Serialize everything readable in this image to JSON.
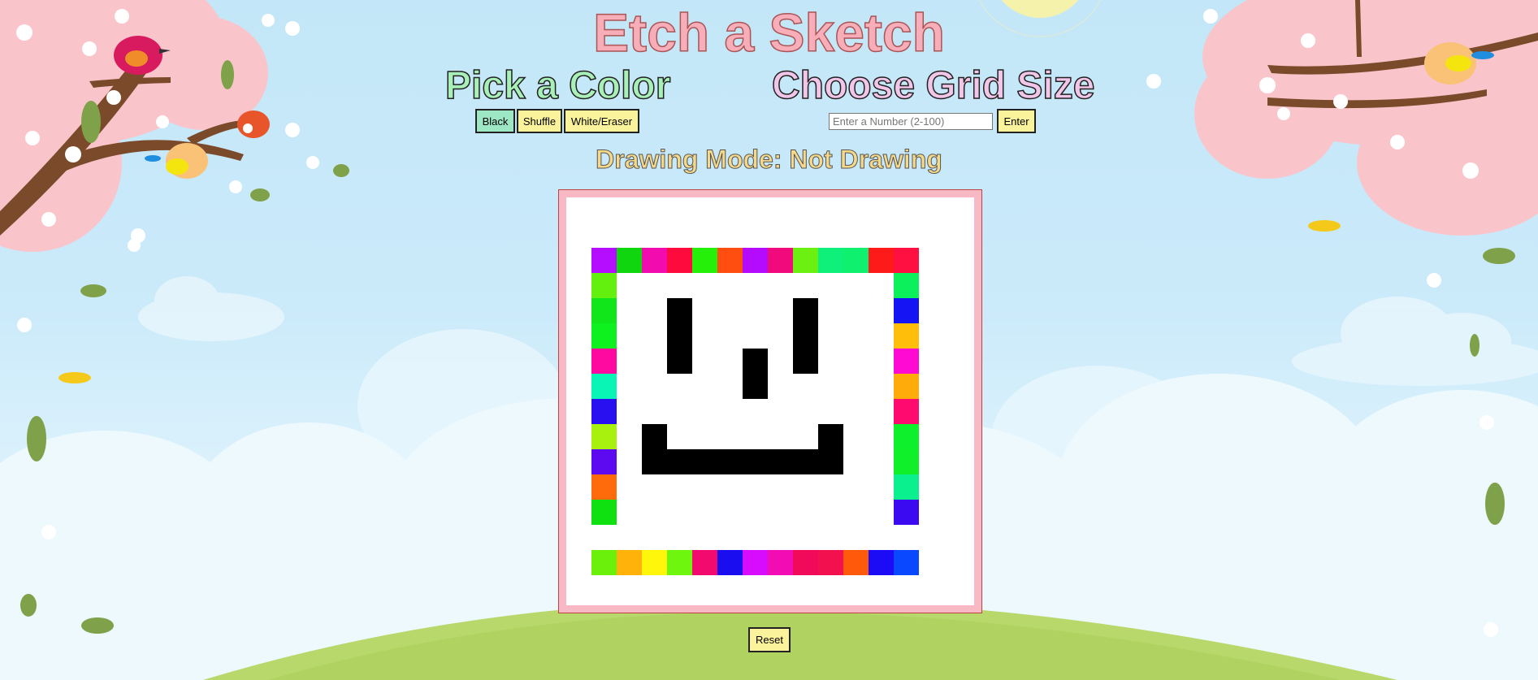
{
  "header": {
    "title": "Etch a Sketch"
  },
  "color_panel": {
    "title": "Pick a Color",
    "buttons": [
      "Black",
      "Shuffle",
      "White/Eraser"
    ]
  },
  "grid_panel": {
    "title": "Choose Grid Size",
    "input_placeholder": "Enter a Number (2-100)",
    "input_value": "",
    "enter_label": "Enter"
  },
  "mode": {
    "text": "Drawing Mode: Not Drawing"
  },
  "board": {
    "border_colors": {
      "top": [
        "#b50dff",
        "#10d60f",
        "#f20cb0",
        "#ff0a3c",
        "#25f00a",
        "#ff4e0f",
        "#b40bff",
        "#f00a7c",
        "#6cf012",
        "#0ef07a",
        "#0ff06e",
        "#ff1a1a",
        "#ff1040"
      ],
      "bottom": [
        "#6bf00c",
        "#ffb20a",
        "#fff60c",
        "#6ff60e",
        "#f20a6e",
        "#1a0ef0",
        "#d70cff",
        "#f20cb4",
        "#f20a5a",
        "#f2104e",
        "#ff5a0c",
        "#1c0cf6",
        "#0a48ff"
      ],
      "left": [
        "#63f00e",
        "#10e61a",
        "#0ff01f",
        "#ff0aa0",
        "#08f5b6",
        "#2810f0",
        "#a8f00e",
        "#5e0af0",
        "#ff6a0a",
        "#0fe00f"
      ],
      "right": [
        "#0cf05c",
        "#1414f5",
        "#ffbe0a",
        "#ff0ad2",
        "#ffab0a",
        "#ff0a6e",
        "#0ff02c",
        "#10f02a",
        "#0af08f",
        "#3c0af0"
      ]
    },
    "black_cells": [
      [
        3,
        2
      ],
      [
        3,
        3
      ],
      [
        3,
        4
      ],
      [
        8,
        2
      ],
      [
        8,
        3
      ],
      [
        8,
        4
      ],
      [
        6,
        4
      ],
      [
        6,
        5
      ],
      [
        2,
        7
      ],
      [
        2,
        8
      ],
      [
        9,
        7
      ],
      [
        9,
        8
      ],
      [
        3,
        8
      ],
      [
        4,
        8
      ],
      [
        5,
        8
      ],
      [
        6,
        8
      ],
      [
        7,
        8
      ],
      [
        8,
        8
      ]
    ]
  },
  "actions": {
    "reset_label": "Reset"
  },
  "colors": {
    "button_yellow": "#fbf29c",
    "button_green": "#9ee7c4",
    "frame_pink": "#f8b9c5"
  }
}
